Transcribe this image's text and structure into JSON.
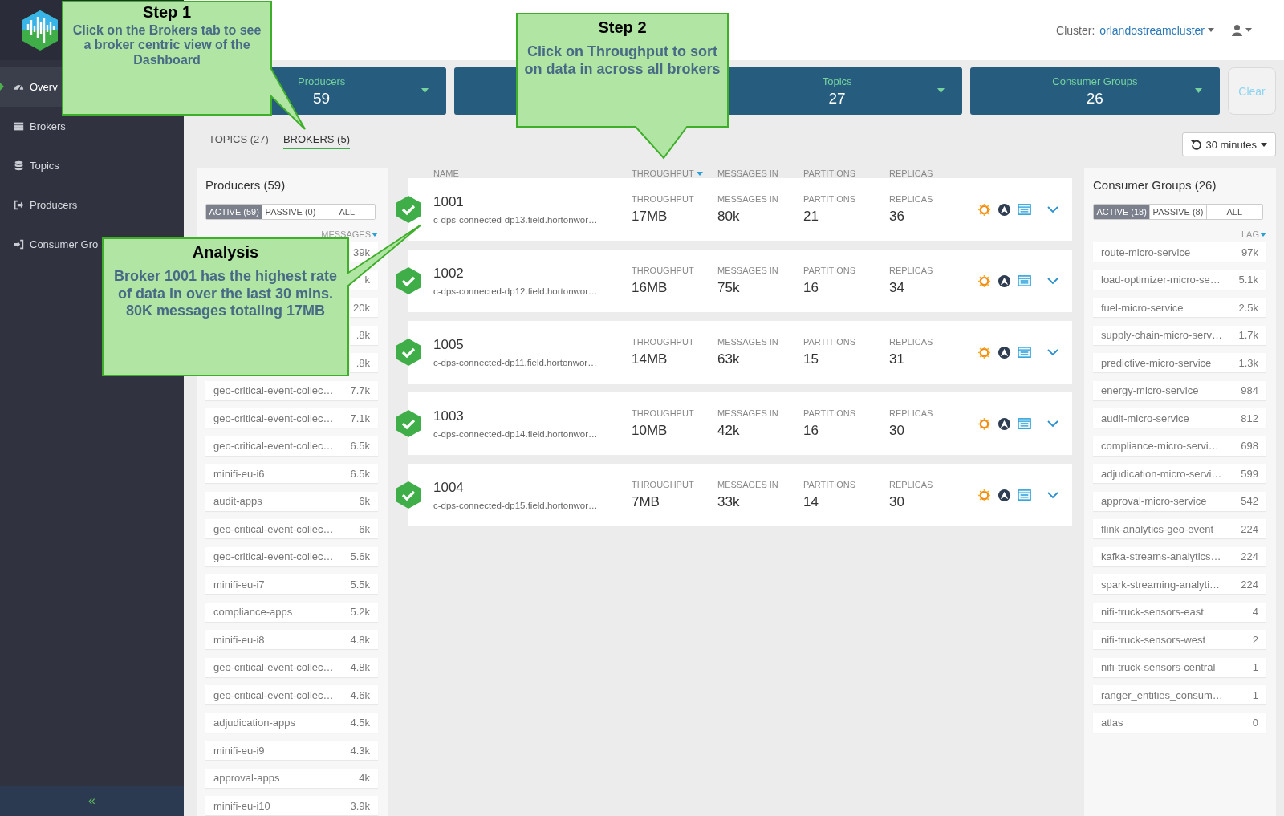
{
  "sidebar": {
    "items": [
      {
        "label": "Overv",
        "selected": true
      },
      {
        "label": "Brokers",
        "selected": false
      },
      {
        "label": "Topics",
        "selected": false
      },
      {
        "label": "Producers",
        "selected": false
      },
      {
        "label": "Consumer Gro",
        "selected": false
      }
    ],
    "collapse": "«"
  },
  "header": {
    "cluster_label": "Cluster:",
    "cluster": "orlandostreamcluster"
  },
  "summary_cards": [
    {
      "kind": "filter",
      "label": "Producers",
      "count": "59"
    },
    {
      "kind": "blank"
    },
    {
      "kind": "filter",
      "label": "Topics",
      "count": "27"
    },
    {
      "kind": "filter",
      "label": "Consumer Groups",
      "count": "26"
    }
  ],
  "clear_button": "Clear",
  "tabs": [
    {
      "label": "TOPICS (27)",
      "selected": false
    },
    {
      "label": "BROKERS (5)",
      "selected": true
    }
  ],
  "time_range": "30 minutes",
  "producers": {
    "title": "Producers (59)",
    "filters": [
      {
        "label": "ACTIVE (59)",
        "selected": true
      },
      {
        "label": "PASSIVE (0)",
        "selected": false
      },
      {
        "label": "ALL",
        "selected": false
      }
    ],
    "sort": {
      "label": "MESSAGES",
      "sorted": true
    },
    "rows": [
      {
        "value": "39k"
      },
      {
        "value": "k"
      },
      {
        "value": "20k"
      },
      {
        "value": ".8k"
      },
      {
        "value": ".8k"
      },
      {
        "name": "geo-critical-event-collec…",
        "value": "7.7k"
      },
      {
        "name": "geo-critical-event-collec…",
        "value": "7.1k"
      },
      {
        "name": "geo-critical-event-collec…",
        "value": "6.5k"
      },
      {
        "name": "minifi-eu-i6",
        "value": "6.5k"
      },
      {
        "name": "audit-apps",
        "value": "6k"
      },
      {
        "name": "geo-critical-event-collec…",
        "value": "6k"
      },
      {
        "name": "geo-critical-event-collec…",
        "value": "5.6k"
      },
      {
        "name": "minifi-eu-i7",
        "value": "5.5k"
      },
      {
        "name": "compliance-apps",
        "value": "5.2k"
      },
      {
        "name": "minifi-eu-i8",
        "value": "4.8k"
      },
      {
        "name": "geo-critical-event-collec…",
        "value": "4.8k"
      },
      {
        "name": "geo-critical-event-collec…",
        "value": "4.6k"
      },
      {
        "name": "adjudication-apps",
        "value": "4.5k"
      },
      {
        "name": "minifi-eu-i9",
        "value": "4.3k"
      },
      {
        "name": "approval-apps",
        "value": "4k"
      },
      {
        "name": "minifi-eu-i10",
        "value": "3.9k"
      }
    ]
  },
  "brokers": {
    "columns": [
      {
        "label": "NAME",
        "sorted": false
      },
      {
        "label": "THROUGHPUT",
        "sorted": true
      },
      {
        "label": "MESSAGES IN",
        "sorted": false
      },
      {
        "label": "PARTITIONS",
        "sorted": false
      },
      {
        "label": "REPLICAS",
        "sorted": false
      }
    ],
    "rows": [
      {
        "id": "1001",
        "host": "c-dps-connected-dp13.field.hortonwor…",
        "stats": [
          {
            "label": "THROUGHPUT",
            "value": "17MB"
          },
          {
            "label": "MESSAGES IN",
            "value": "80k"
          },
          {
            "label": "PARTITIONS",
            "value": "21"
          },
          {
            "label": "REPLICAS",
            "value": "36"
          }
        ]
      },
      {
        "id": "1002",
        "host": "c-dps-connected-dp12.field.hortonwor…",
        "stats": [
          {
            "label": "THROUGHPUT",
            "value": "16MB"
          },
          {
            "label": "MESSAGES IN",
            "value": "75k"
          },
          {
            "label": "PARTITIONS",
            "value": "16"
          },
          {
            "label": "REPLICAS",
            "value": "34"
          }
        ]
      },
      {
        "id": "1005",
        "host": "c-dps-connected-dp11.field.hortonwor…",
        "stats": [
          {
            "label": "THROUGHPUT",
            "value": "14MB"
          },
          {
            "label": "MESSAGES IN",
            "value": "63k"
          },
          {
            "label": "PARTITIONS",
            "value": "15"
          },
          {
            "label": "REPLICAS",
            "value": "31"
          }
        ]
      },
      {
        "id": "1003",
        "host": "c-dps-connected-dp14.field.hortonwor…",
        "stats": [
          {
            "label": "THROUGHPUT",
            "value": "10MB"
          },
          {
            "label": "MESSAGES IN",
            "value": "42k"
          },
          {
            "label": "PARTITIONS",
            "value": "16"
          },
          {
            "label": "REPLICAS",
            "value": "30"
          }
        ]
      },
      {
        "id": "1004",
        "host": "c-dps-connected-dp15.field.hortonwor…",
        "stats": [
          {
            "label": "THROUGHPUT",
            "value": "7MB"
          },
          {
            "label": "MESSAGES IN",
            "value": "33k"
          },
          {
            "label": "PARTITIONS",
            "value": "14"
          },
          {
            "label": "REPLICAS",
            "value": "30"
          }
        ]
      }
    ]
  },
  "consumer_groups": {
    "title": "Consumer Groups (26)",
    "filters": [
      {
        "label": "ACTIVE (18)",
        "selected": true
      },
      {
        "label": "PASSIVE (8)",
        "selected": false
      },
      {
        "label": "ALL",
        "selected": false
      }
    ],
    "sort": {
      "label": "LAG",
      "sorted": true
    },
    "rows": [
      {
        "name": "route-micro-service",
        "value": "97k"
      },
      {
        "name": "load-optimizer-micro-se…",
        "value": "5.1k"
      },
      {
        "name": "fuel-micro-service",
        "value": "2.5k"
      },
      {
        "name": "supply-chain-micro-serv…",
        "value": "1.7k"
      },
      {
        "name": "predictive-micro-service",
        "value": "1.3k"
      },
      {
        "name": "energy-micro-service",
        "value": "984"
      },
      {
        "name": "audit-micro-service",
        "value": "812"
      },
      {
        "name": "compliance-micro-servi…",
        "value": "698"
      },
      {
        "name": "adjudication-micro-servi…",
        "value": "599"
      },
      {
        "name": "approval-micro-service",
        "value": "542"
      },
      {
        "name": "flink-analytics-geo-event",
        "value": "224"
      },
      {
        "name": "kafka-streams-analytics…",
        "value": "224"
      },
      {
        "name": "spark-streaming-analyti…",
        "value": "224"
      },
      {
        "name": "nifi-truck-sensors-east",
        "value": "4"
      },
      {
        "name": "nifi-truck-sensors-west",
        "value": "2"
      },
      {
        "name": "nifi-truck-sensors-central",
        "value": "1"
      },
      {
        "name": "ranger_entities_consum…",
        "value": "1"
      },
      {
        "name": "atlas",
        "value": "0"
      }
    ]
  },
  "callouts": [
    {
      "title": "Step 1",
      "text": "Click on the Brokers tab to see a broker centric view of the Dashboard"
    },
    {
      "title": "Step 2",
      "text": "Click on Throughput to sort on data in across all brokers"
    },
    {
      "title": "Analysis",
      "text": "Broker 1001 has the highest rate of data in over the last 30 mins. 80K messages totaling 17MB"
    }
  ]
}
